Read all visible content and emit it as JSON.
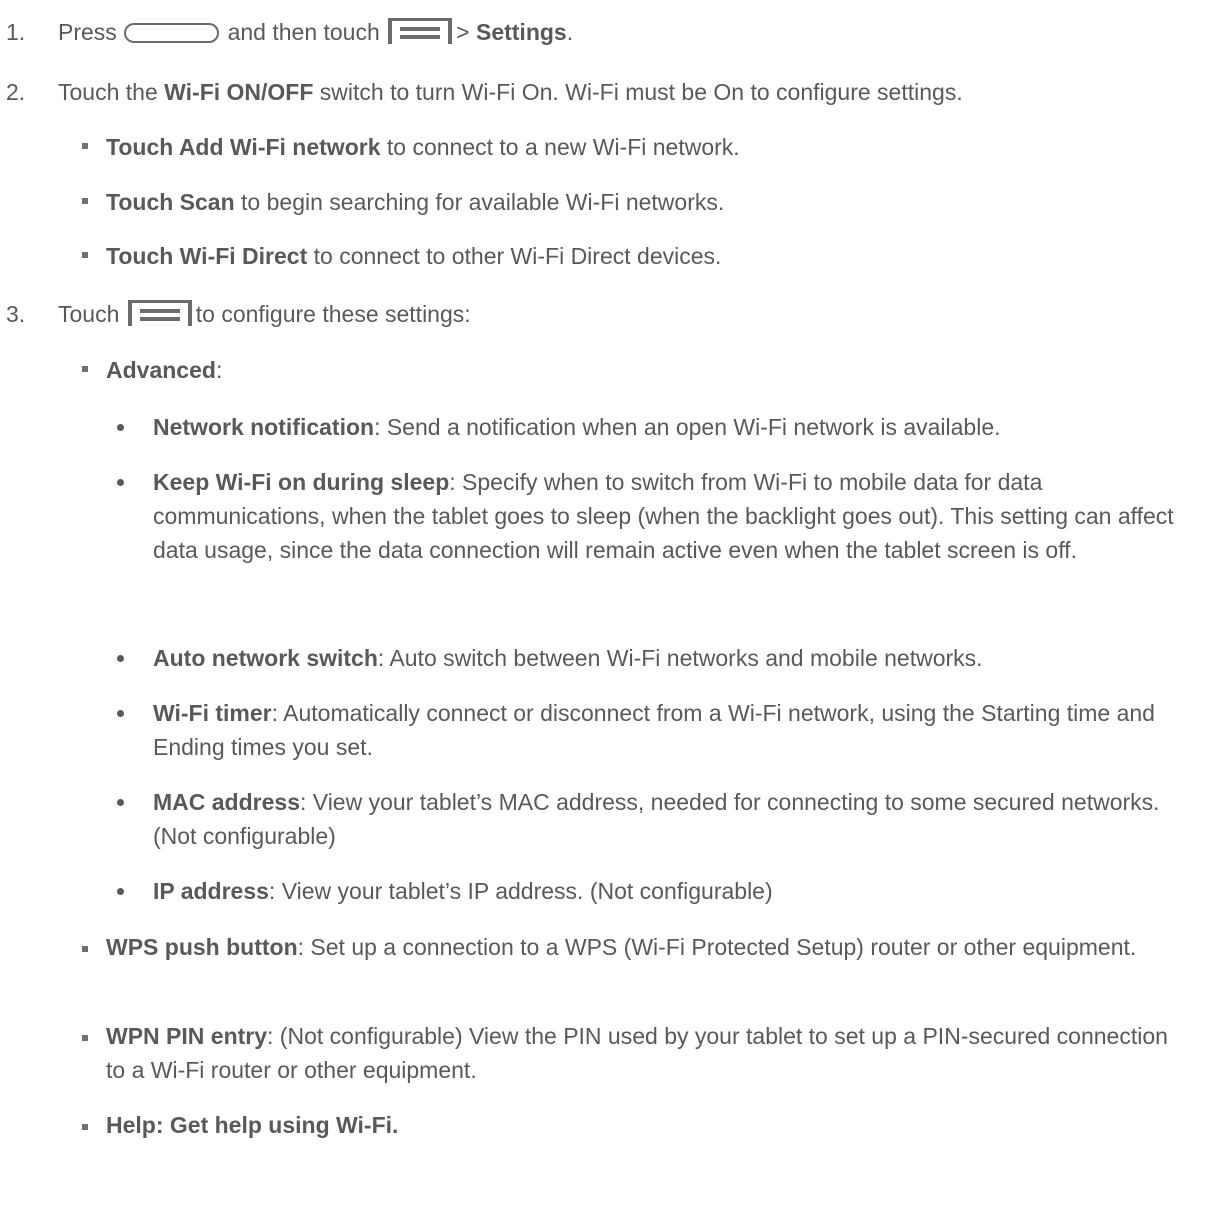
{
  "steps": [
    {
      "number": "1.",
      "parts": {
        "a": "Press",
        "b": "and then touch",
        "c": ">",
        "d": "Settings",
        "e": "."
      }
    },
    {
      "number": "2.",
      "parts": {
        "a": "Touch the",
        "b": "Wi-Fi ON/OFF",
        "c": "switch to turn Wi-Fi On. Wi-Fi must be On to configure settings."
      },
      "bullets": [
        {
          "bold": "Touch Add Wi-Fi network",
          "text": " to connect to a new Wi-Fi network."
        },
        {
          "bold": "Touch Scan",
          "text": " to begin searching for available Wi-Fi networks."
        },
        {
          "bold": "Touch Wi-Fi Direct",
          "text": " to connect to other Wi-Fi Direct devices."
        }
      ]
    },
    {
      "number": "3.",
      "parts": {
        "a": "Touch",
        "b": "to configure these settings:"
      }
    }
  ],
  "advanced": {
    "bold": "Advanced",
    "text": ":",
    "items": [
      {
        "bold": "Network notification",
        "text": ": Send a notification when an open Wi-Fi network is available."
      },
      {
        "bold": "Keep Wi-Fi on during sleep",
        "text": ": Specify when to switch from Wi-Fi to mobile data for data communications, when the tablet goes to sleep (when the backlight goes out). This setting can affect data usage, since the data connection will remain active even when the tablet screen is off."
      },
      {
        "bold": "Auto network switch",
        "text": ": Auto switch between Wi-Fi networks and mobile networks."
      },
      {
        "bold": "Wi-Fi timer",
        "text": ": Automatically connect or disconnect from a Wi-Fi network, using the Starting time and Ending times you set."
      },
      {
        "bold": "MAC address",
        "text": ": View your tablet’s MAC address, needed for connecting to some secured networks. (Not configurable)"
      },
      {
        "bold": "IP address",
        "text": ": View your tablet’s IP address. (Not configurable)"
      }
    ]
  },
  "more_settings": [
    {
      "bold": "WPS push button",
      "text": ": Set up a connection to a WPS (Wi-Fi Protected Setup) router or other equipment."
    },
    {
      "bold": "WPN PIN entry",
      "text": ": (Not configurable) View the PIN used by your tablet to set up a PIN-secured connection to a Wi-Fi router or other equipment."
    },
    {
      "bold": "Help: Get help using Wi-Fi.",
      "text": ""
    }
  ],
  "icons": {
    "home_key": "home-key-icon",
    "menu_key": "menu-key-icon"
  },
  "colors": {
    "text": "#595959"
  }
}
